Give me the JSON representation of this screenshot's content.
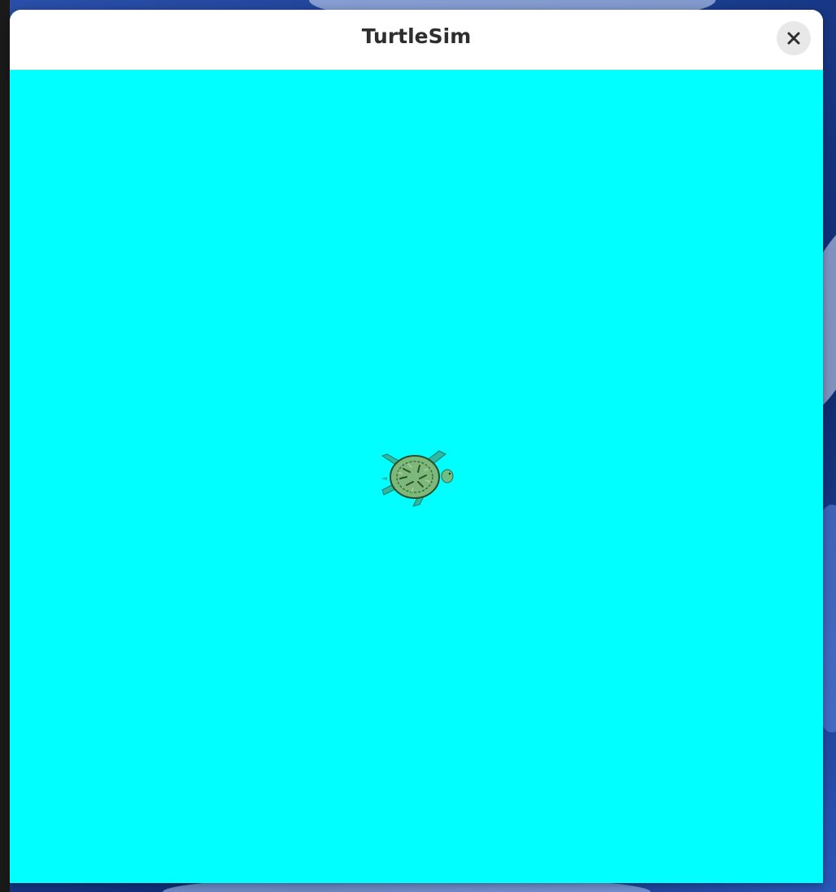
{
  "window": {
    "title": "TurtleSim",
    "close_icon": "close-icon"
  },
  "canvas": {
    "background_color": "#00ffff"
  },
  "turtle": {
    "icon": "turtle-icon",
    "shell_color": "#7cb87a",
    "limb_color": "#2fb8a0"
  }
}
